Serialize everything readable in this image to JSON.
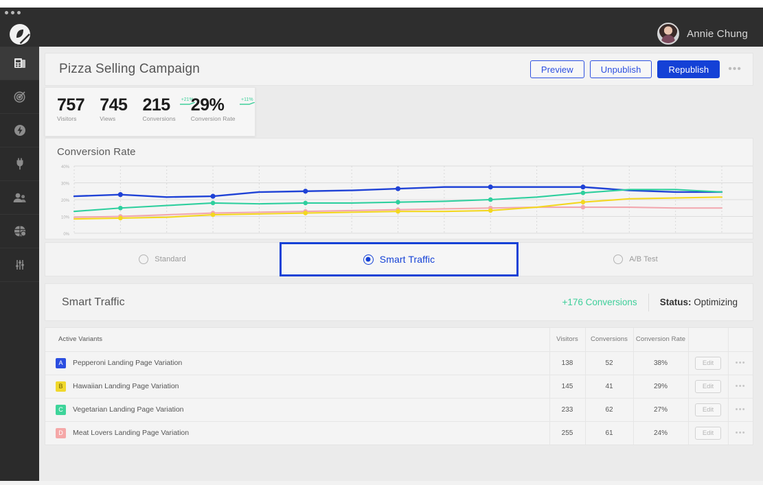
{
  "app": {
    "logo_icon": "ecliptic-logo-icon",
    "user_name": "Annie Chung",
    "avatar_icon": "user-avatar"
  },
  "sidebar": {
    "items": [
      {
        "icon": "pages-icon",
        "name": "pages",
        "active": true
      },
      {
        "icon": "target-icon",
        "name": "goals",
        "active": false
      },
      {
        "icon": "lightning-bolt-icon",
        "name": "automation",
        "active": false
      },
      {
        "icon": "plug-icon",
        "name": "integrations",
        "active": false
      },
      {
        "icon": "people-icon",
        "name": "audience",
        "active": false
      },
      {
        "icon": "globe-icon",
        "name": "domains",
        "active": false
      },
      {
        "icon": "sliders-icon",
        "name": "settings",
        "active": false
      }
    ]
  },
  "header": {
    "title": "Pizza Selling Campaign",
    "preview_label": "Preview",
    "unpublish_label": "Unpublish",
    "republish_label": "Republish",
    "overflow_icon": "kebab-menu-icon",
    "overflow_glyph": "•••"
  },
  "stats": {
    "items": [
      {
        "value": "757",
        "label": "Visitors",
        "delta": ""
      },
      {
        "value": "745",
        "label": "Views",
        "delta": ""
      },
      {
        "value": "215",
        "label": "Conversions",
        "delta": "+21%"
      },
      {
        "value": "29%",
        "label": "Conversion Rate",
        "delta": "+11%"
      }
    ],
    "delta_color": "#3ecf9a"
  },
  "chart_data": {
    "type": "line",
    "title": "Conversion Rate",
    "xlabel": "",
    "ylabel": "",
    "ylim": [
      0,
      40
    ],
    "yticks": [
      0,
      10,
      20,
      30,
      40
    ],
    "ytick_labels": [
      "0%",
      "10%",
      "20%",
      "30%",
      "40%"
    ],
    "grid": true,
    "legend": "none",
    "x": [
      1,
      2,
      3,
      4,
      5,
      6,
      7,
      8,
      9,
      10,
      11,
      12,
      13,
      14,
      15
    ],
    "series": [
      {
        "name": "Pepperoni Landing Page Variation",
        "color": "#1f42d6",
        "values": [
          22.0,
          23.0,
          21.5,
          22.0,
          24.5,
          25.0,
          25.5,
          26.5,
          27.5,
          27.5,
          27.5,
          27.5,
          25.5,
          24.5,
          24.5
        ]
      },
      {
        "name": "Vegetarian Landing Page Variation",
        "color": "#2ecf9e",
        "values": [
          13.0,
          15.0,
          16.5,
          18.0,
          17.5,
          18.0,
          18.0,
          18.5,
          19.0,
          20.0,
          21.5,
          24.0,
          26.0,
          26.0,
          24.5
        ]
      },
      {
        "name": "Meat Lovers Landing Page Variation",
        "color": "#f2a6ae",
        "values": [
          9.5,
          10.0,
          11.0,
          12.0,
          12.5,
          13.0,
          13.5,
          14.0,
          14.5,
          15.0,
          15.5,
          15.5,
          15.5,
          15.0,
          15.0
        ]
      },
      {
        "name": "Hawaiian Landing Page Variation",
        "color": "#f3d71f",
        "values": [
          8.5,
          9.0,
          9.5,
          11.0,
          11.5,
          12.0,
          12.5,
          13.0,
          13.0,
          13.5,
          15.5,
          18.5,
          20.5,
          21.0,
          21.5
        ]
      }
    ]
  },
  "modes": {
    "options": [
      {
        "label": "Standard",
        "selected": false
      },
      {
        "label": "Smart Traffic",
        "selected": true
      },
      {
        "label": "A/B Test",
        "selected": false
      }
    ],
    "accent_color": "#1441d6"
  },
  "status": {
    "title": "Smart Traffic",
    "conversions_delta": "+176 Conversions",
    "status_prefix": "Status:",
    "status_value": "Optimizing",
    "delta_color": "#3ecf9a"
  },
  "table": {
    "headers": {
      "name": "Active Variants",
      "visitors": "Visitors",
      "conversions": "Conversions",
      "rate": "Conversion Rate",
      "edit": "",
      "more": ""
    },
    "edit_label": "Edit",
    "more_glyph": "•••",
    "rows": [
      {
        "badge": "A",
        "badge_color": "#2b4ee0",
        "name": "Pepperoni Landing Page Variation",
        "visitors": "138",
        "conversions": "52",
        "rate": "38%"
      },
      {
        "badge": "B",
        "badge_color": "#f0d82c",
        "name": "Hawaiian Landing Page Variation",
        "visitors": "145",
        "conversions": "41",
        "rate": "29%"
      },
      {
        "badge": "C",
        "badge_color": "#3ed49a",
        "name": "Vegetarian Landing Page Variation",
        "visitors": "233",
        "conversions": "62",
        "rate": "27%"
      },
      {
        "badge": "D",
        "badge_color": "#f5a8a8",
        "name": "Meat Lovers Landing Page Variation",
        "visitors": "255",
        "conversions": "61",
        "rate": "24%"
      }
    ]
  }
}
